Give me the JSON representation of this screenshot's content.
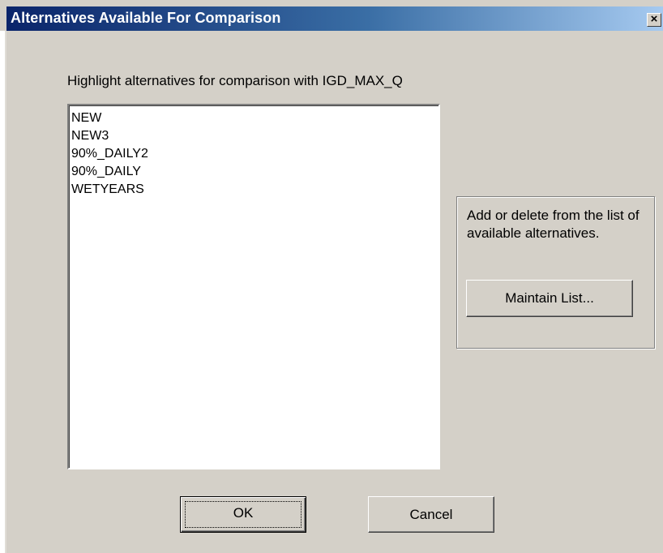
{
  "window": {
    "title": "Alternatives Available For Comparison",
    "close_glyph": "×",
    "accent": "#0a246a",
    "face_color": "#d4d0c8"
  },
  "instruction": "Highlight alternatives for comparison with IGD_MAX_Q",
  "alternatives": {
    "items": [
      "NEW",
      "NEW3",
      "90%_DAILY2",
      "90%_DAILY",
      "WETYEARS"
    ]
  },
  "maintain_group": {
    "description": "Add or delete from the list of available alternatives.",
    "button_label": "Maintain List..."
  },
  "footer": {
    "ok_label": "OK",
    "cancel_label": "Cancel"
  }
}
